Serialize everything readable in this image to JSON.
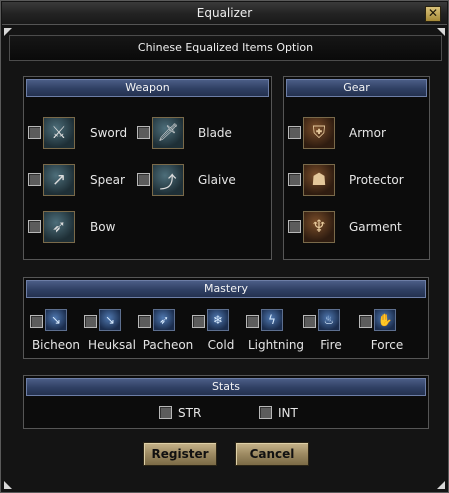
{
  "window": {
    "title": "Equalizer",
    "close_label": "✕"
  },
  "subheader": "Chinese Equalized Items Option",
  "weapon": {
    "header": "Weapon",
    "items": [
      {
        "label": "Sword",
        "icon": "sword-icon",
        "glyph": "⚔"
      },
      {
        "label": "Blade",
        "icon": "blade-icon",
        "glyph": "🗡"
      },
      {
        "label": "Spear",
        "icon": "spear-icon",
        "glyph": "↗"
      },
      {
        "label": "Glaive",
        "icon": "glaive-icon",
        "glyph": "⤴"
      },
      {
        "label": "Bow",
        "icon": "bow-icon",
        "glyph": "➶"
      }
    ]
  },
  "gear": {
    "header": "Gear",
    "items": [
      {
        "label": "Armor",
        "icon": "armor-icon",
        "glyph": "⛨"
      },
      {
        "label": "Protector",
        "icon": "protector-icon",
        "glyph": "☗"
      },
      {
        "label": "Garment",
        "icon": "garment-icon",
        "glyph": "♆"
      }
    ]
  },
  "mastery": {
    "header": "Mastery",
    "items": [
      {
        "label": "Bicheon",
        "glyph": "↘"
      },
      {
        "label": "Heuksal",
        "glyph": "↘"
      },
      {
        "label": "Pacheon",
        "glyph": "➶"
      },
      {
        "label": "Cold",
        "glyph": "❄"
      },
      {
        "label": "Lightning",
        "glyph": "ϟ"
      },
      {
        "label": "Fire",
        "glyph": "♨"
      },
      {
        "label": "Force",
        "glyph": "✋"
      }
    ]
  },
  "stats": {
    "header": "Stats",
    "items": [
      {
        "label": "STR"
      },
      {
        "label": "INT"
      }
    ]
  },
  "buttons": {
    "register": "Register",
    "cancel": "Cancel"
  },
  "colors": {
    "panel_header": "#2f3f63",
    "button": "#9d8a62",
    "background": "#141414"
  }
}
